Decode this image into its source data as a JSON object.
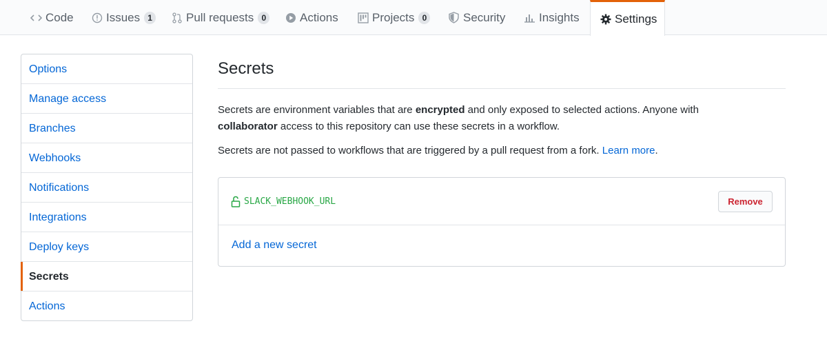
{
  "tabs": [
    {
      "label": "Code",
      "icon": "code-icon"
    },
    {
      "label": "Issues",
      "icon": "issue-opened-icon",
      "count": "1"
    },
    {
      "label": "Pull requests",
      "icon": "git-pull-request-icon",
      "count": "0"
    },
    {
      "label": "Actions",
      "icon": "play-icon"
    },
    {
      "label": "Projects",
      "icon": "project-icon",
      "count": "0"
    },
    {
      "label": "Security",
      "icon": "shield-icon"
    },
    {
      "label": "Insights",
      "icon": "graph-icon"
    },
    {
      "label": "Settings",
      "icon": "gear-icon",
      "selected": true
    }
  ],
  "sidebar": {
    "items": [
      {
        "label": "Options"
      },
      {
        "label": "Manage access"
      },
      {
        "label": "Branches"
      },
      {
        "label": "Webhooks"
      },
      {
        "label": "Notifications"
      },
      {
        "label": "Integrations"
      },
      {
        "label": "Deploy keys"
      },
      {
        "label": "Secrets",
        "active": true
      },
      {
        "label": "Actions"
      }
    ]
  },
  "main": {
    "title": "Secrets",
    "para1": {
      "t1": "Secrets are environment variables that are ",
      "b1": "encrypted",
      "t2": " and only exposed to selected actions. Anyone with",
      "b2": "collaborator",
      "t3": " access to this repository can use these secrets in a workflow."
    },
    "para2": {
      "text": "Secrets are not passed to workflows that are triggered by a pull request from a fork. ",
      "link": "Learn more",
      "end": "."
    },
    "secrets": [
      {
        "name": "SLACK_WEBHOOK_URL",
        "remove_label": "Remove"
      }
    ],
    "add_label": "Add a new secret"
  },
  "colors": {
    "accent": "#e36209",
    "link": "#0366d6",
    "secret_green": "#28a745",
    "danger": "#cb2431"
  }
}
